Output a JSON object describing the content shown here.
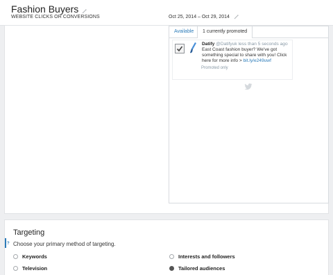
{
  "campaign": {
    "title": "Fashion Buyers",
    "objective": "WEBSITE CLICKS OR CONVERSIONS",
    "date_range": "Oct 25, 2014 – Oct 29, 2014"
  },
  "preview": {
    "tabs": [
      {
        "label": "Available",
        "selected": false
      },
      {
        "label": "1 currently promoted",
        "selected": true
      }
    ],
    "tweet": {
      "checked": true,
      "author": "Datify",
      "handle_time": "@Datifyuk less than 5 seconds ago",
      "text": "East Coast fashion buyer? We've got something special to share with you! Click here for more info >",
      "link": "bit.ly/e249uwf",
      "footer": "Promoted only"
    }
  },
  "targeting": {
    "title": "Targeting",
    "help_marker": "?",
    "question": "Choose your primary method of targeting.",
    "options": [
      {
        "label": "Keywords",
        "selected": false
      },
      {
        "label": "Interests and followers",
        "selected": false
      },
      {
        "label": "Television",
        "selected": false
      },
      {
        "label": "Tailored audiences",
        "selected": true
      }
    ]
  },
  "colors": {
    "accent": "#2b7bb9",
    "background": "#eeeff1"
  }
}
